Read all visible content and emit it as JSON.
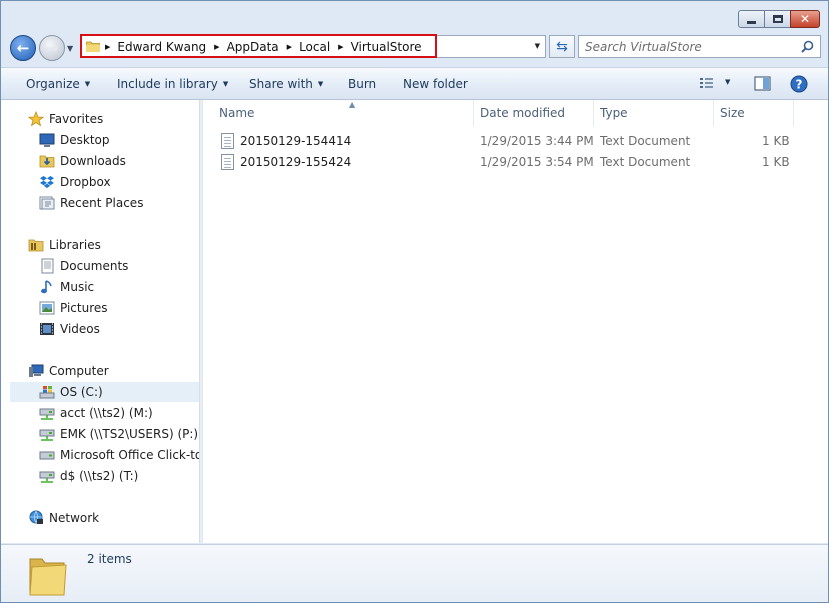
{
  "window": {
    "caption_buttons": {
      "minimize": "minimize",
      "maximize": "maximize",
      "close": "✕"
    }
  },
  "address_bar": {
    "crumbs": [
      "Edward Kwang",
      "AppData",
      "Local",
      "VirtualStore"
    ],
    "highlight_color": "#d60f16"
  },
  "search": {
    "placeholder": "Search VirtualStore"
  },
  "toolbar": {
    "organize": "Organize",
    "include_in_library": "Include in library",
    "share_with": "Share with",
    "burn": "Burn",
    "new_folder": "New folder"
  },
  "navpane": {
    "favorites": {
      "label": "Favorites",
      "items": [
        "Desktop",
        "Downloads",
        "Dropbox",
        "Recent Places"
      ]
    },
    "libraries": {
      "label": "Libraries",
      "items": [
        "Documents",
        "Music",
        "Pictures",
        "Videos"
      ]
    },
    "computer": {
      "label": "Computer",
      "items": [
        "OS (C:)",
        "acct (\\\\ts2) (M:)",
        "EMK (\\\\TS2\\USERS) (P:)",
        "Microsoft Office Click-to-Run",
        "d$ (\\\\ts2) (T:)"
      ],
      "selected": "OS (C:)"
    },
    "network": {
      "label": "Network"
    }
  },
  "filelist": {
    "columns": {
      "name": "Name",
      "date": "Date modified",
      "type": "Type",
      "size": "Size"
    },
    "rows": [
      {
        "name": "20150129-154414",
        "date": "1/29/2015 3:44 PM",
        "type": "Text Document",
        "size": "1 KB"
      },
      {
        "name": "20150129-155424",
        "date": "1/29/2015 3:54 PM",
        "type": "Text Document",
        "size": "1 KB"
      }
    ]
  },
  "details": {
    "item_count": "2 items"
  }
}
